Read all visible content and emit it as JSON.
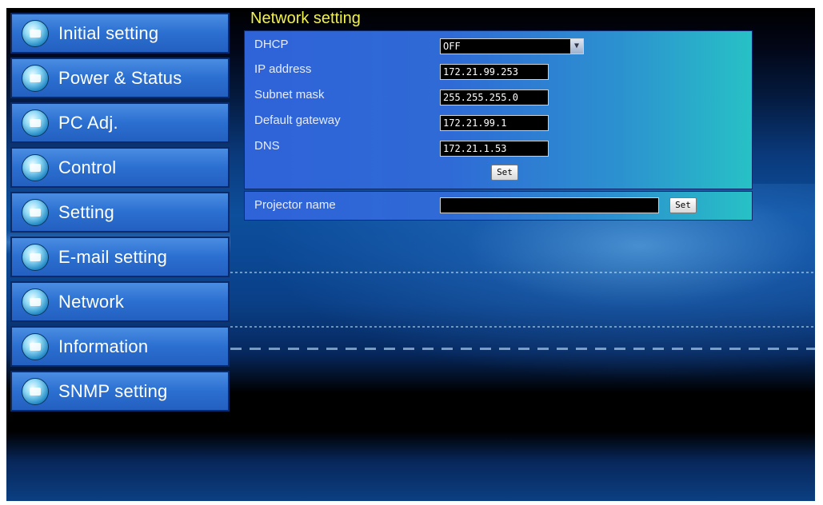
{
  "sidebar": {
    "items": [
      {
        "label": "Initial setting",
        "icon": "initial-setting-icon"
      },
      {
        "label": "Power & Status",
        "icon": "power-status-icon"
      },
      {
        "label": "PC Adj.",
        "icon": "pc-adj-icon"
      },
      {
        "label": "Control",
        "icon": "control-icon"
      },
      {
        "label": "Setting",
        "icon": "setting-icon"
      },
      {
        "label": "E-mail setting",
        "icon": "email-icon"
      },
      {
        "label": "Network",
        "icon": "network-icon"
      },
      {
        "label": "Information",
        "icon": "information-icon"
      },
      {
        "label": "SNMP setting",
        "icon": "snmp-icon"
      }
    ]
  },
  "network": {
    "title": "Network setting",
    "dhcp_label": "DHCP",
    "dhcp_value": "OFF",
    "ip_label": "IP address",
    "ip_value": "172.21.99.253",
    "subnet_label": "Subnet mask",
    "subnet_value": "255.255.255.0",
    "gateway_label": "Default gateway",
    "gateway_value": "172.21.99.1",
    "dns_label": "DNS",
    "dns_value": "172.21.1.53",
    "set_label": "Set",
    "projector_name_label": "Projector name",
    "projector_name_value": "",
    "projector_set_label": "Set"
  },
  "colors": {
    "title": "#f2f24a",
    "nav_bg": "#2b6fd0",
    "panel_bg": "#2f63d8"
  }
}
